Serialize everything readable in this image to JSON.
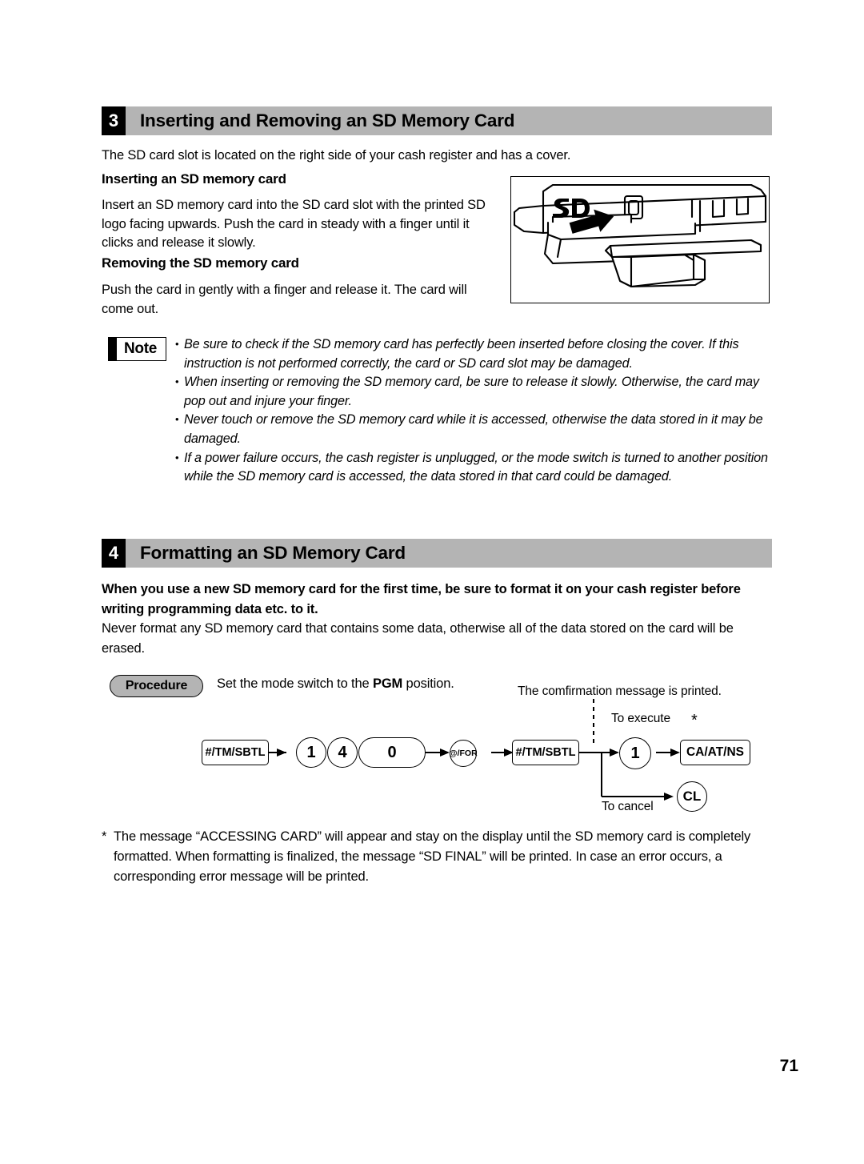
{
  "page": {
    "number": "71"
  },
  "sections": [
    {
      "num": "3",
      "title": "Inserting and Removing an SD Memory Card",
      "intro": "The SD card slot is located on the right side of your cash register and has a cover.",
      "sub1_head": "Inserting an SD memory card",
      "sub1_body": "Insert an SD memory card into the SD card slot with the printed SD logo facing upwards. Push the card in steady with a finger until it clicks and release it slowly.",
      "sub2_head": "Removing the SD memory card",
      "sub2_body": "Push the card in gently with a finger and release it. The card will come out."
    },
    {
      "num": "4",
      "title": "Formatting an SD Memory Card",
      "bold_para": "When you use a new SD memory card for the first time, be sure to format it on your cash register before writing programming data etc. to it.",
      "para": "Never format any SD memory card that contains some data, otherwise all of the data stored on the card will be erased."
    }
  ],
  "illustration": {
    "alt": "sd-card-slot-illustration",
    "logo_text": "SD"
  },
  "note": {
    "label": "Note",
    "items": [
      "Be sure to check if the SD memory card has perfectly been inserted before closing the cover. If this instruction is not performed correctly, the card or SD card slot may be damaged.",
      "When inserting or removing the SD memory card, be sure to release it slowly. Otherwise, the card may pop out and injure your finger.",
      "Never touch or remove the SD memory card while it is accessed, otherwise the data stored in it may be damaged.",
      "If a power failure occurs, the cash register is unplugged, or the mode switch is turned to another position while the SD memory card is accessed, the data stored in that card could be damaged."
    ]
  },
  "procedure": {
    "label": "Procedure",
    "instruction_prefix": "Set the mode switch to the ",
    "instruction_mode": "PGM",
    "instruction_suffix": " position.",
    "flow": {
      "keys": [
        {
          "id": "k1",
          "label": "#/TM/SBTL",
          "shape": "rect"
        },
        {
          "id": "k2",
          "label": "1",
          "shape": "circle"
        },
        {
          "id": "k3",
          "label": "4",
          "shape": "circle"
        },
        {
          "id": "k4",
          "label": "0",
          "shape": "pill"
        },
        {
          "id": "k5",
          "label": "@/FOR",
          "shape": "circle"
        },
        {
          "id": "k6",
          "label": "#/TM/SBTL",
          "shape": "rect"
        },
        {
          "id": "k7",
          "label": "1",
          "shape": "circle"
        },
        {
          "id": "k8",
          "label": "CA/AT/NS",
          "shape": "rect"
        },
        {
          "id": "k9",
          "label": "CL",
          "shape": "circle"
        }
      ],
      "labels": {
        "confirmation": "The comfirmation message is printed.",
        "to_execute": "To execute",
        "to_cancel": "To cancel",
        "asterisk": "*"
      }
    }
  },
  "footnote": {
    "marker": "*",
    "text": "The message “ACCESSING CARD” will appear and stay on the display until the SD memory card is completely formatted. When formatting is finalized, the message “SD FINAL” will be printed. In case an error occurs, a corresponding error message will be printed."
  }
}
